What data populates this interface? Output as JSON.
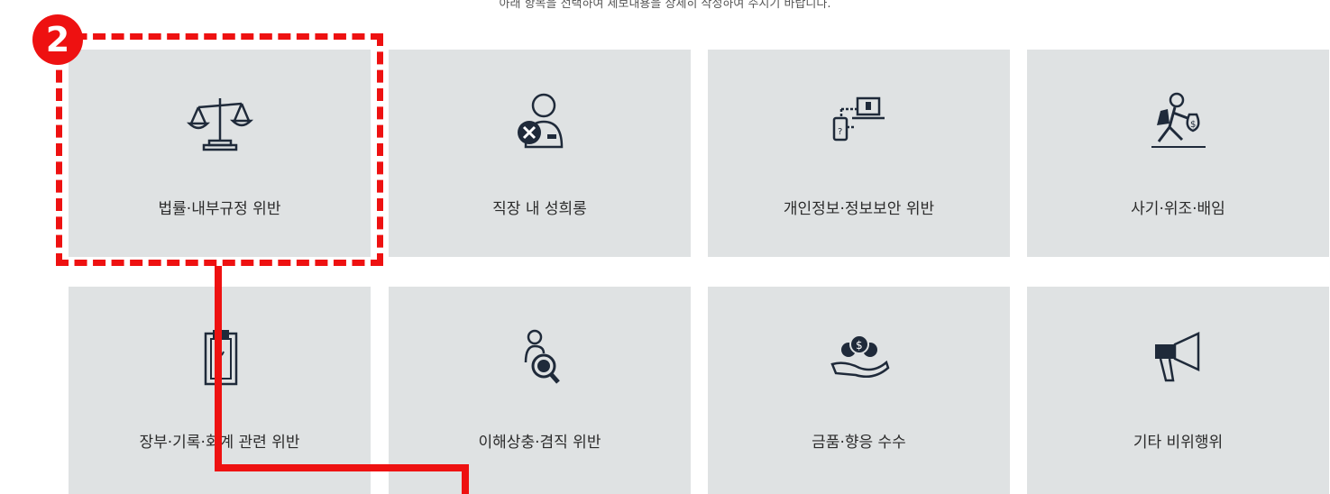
{
  "instruction": "아래 항목을 선택하여 제보내용을 상세히 작성하여 주시기 바랍니다.",
  "annotation": {
    "step_number": "2",
    "color": "#ee1111"
  },
  "categories": [
    {
      "label": "법률·내부규정 위반",
      "icon": "scales-icon"
    },
    {
      "label": "직장 내 성희롱",
      "icon": "person-forbidden-icon"
    },
    {
      "label": "개인정보·정보보안 위반",
      "icon": "devices-info-icon"
    },
    {
      "label": "사기·위조·배임",
      "icon": "thief-moneybag-icon"
    },
    {
      "label": "장부·기록·회계 관련 위반",
      "icon": "clipboard-icon"
    },
    {
      "label": "이해상충·겸직 위반",
      "icon": "person-search-icon"
    },
    {
      "label": "금품·향응 수수",
      "icon": "hand-coins-icon"
    },
    {
      "label": "기타 비위행위",
      "icon": "megaphone-icon"
    }
  ]
}
